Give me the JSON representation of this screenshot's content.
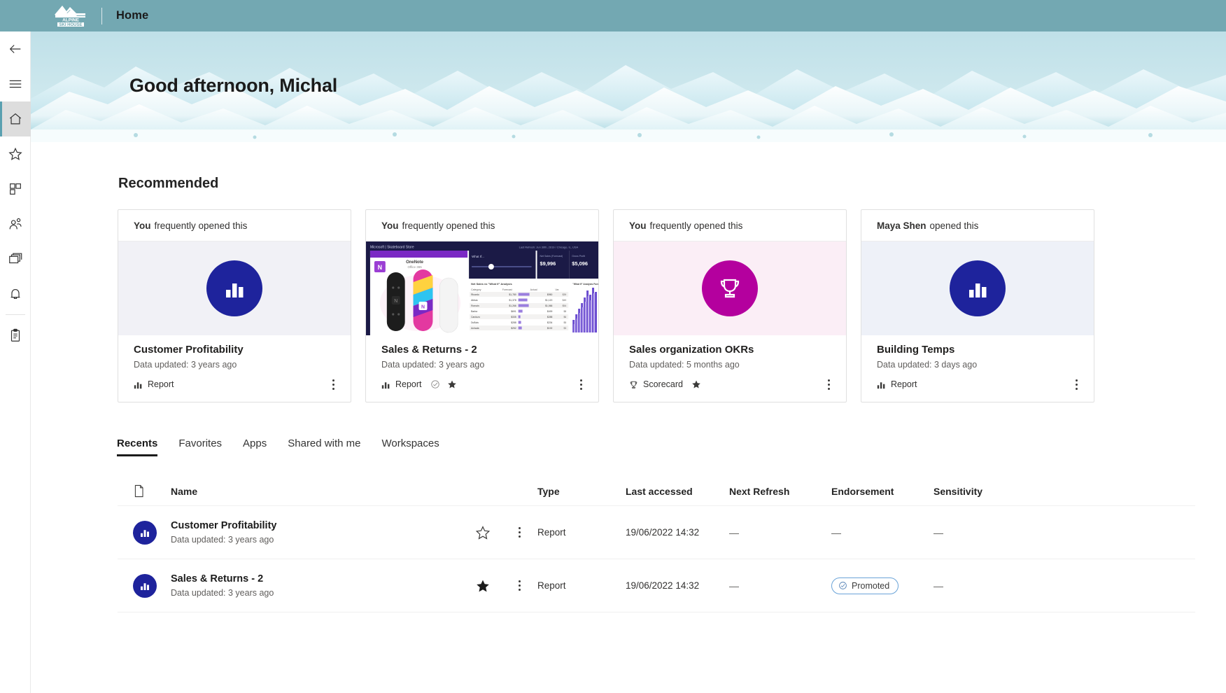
{
  "topbar": {
    "brand_line1": "ALPINE",
    "brand_line2": "SKI HOUSE",
    "title": "Home"
  },
  "rail": {
    "items": [
      {
        "name": "back",
        "label": "Back",
        "icon": "arrow-left-icon"
      },
      {
        "name": "menu",
        "label": "Show navigation",
        "icon": "hamburger-icon"
      },
      {
        "name": "home",
        "label": "Home",
        "icon": "home-icon",
        "selected": true
      },
      {
        "name": "favorites",
        "label": "Favorites",
        "icon": "star-icon"
      },
      {
        "name": "apps",
        "label": "Apps",
        "icon": "apps-grid-icon"
      },
      {
        "name": "shared-with-me",
        "label": "Shared with me",
        "icon": "people-icon"
      },
      {
        "name": "workspaces",
        "label": "Workspaces",
        "icon": "workspaces-stack-icon"
      },
      {
        "name": "notifications",
        "label": "Notifications",
        "icon": "bell-icon"
      },
      {
        "name": "metrics",
        "label": "Metrics",
        "icon": "clipboard-icon"
      }
    ]
  },
  "hero": {
    "greeting": "Good afternoon, Michal"
  },
  "main": {
    "recommended_title": "Recommended",
    "cards": [
      {
        "actor": "You",
        "activity": "frequently opened this",
        "thumb_kind": "circle-blue-bars",
        "thumb_bg": "#f1f1f6",
        "title": "Customer Profitability",
        "subtitle": "Data updated: 3 years ago",
        "type_label": "Report",
        "type_icon": "report-bars-icon",
        "certified": false,
        "favorite": false
      },
      {
        "actor": "You",
        "activity": "frequently opened this",
        "thumb_kind": "report-preview",
        "thumb_bg": "#1b1a46",
        "title": "Sales & Returns  - 2",
        "subtitle": "Data updated: 3 years ago",
        "type_label": "Report",
        "type_icon": "report-bars-icon",
        "certified": true,
        "favorite": true
      },
      {
        "actor": "You",
        "activity": "frequently opened this",
        "thumb_kind": "circle-magenta-trophy",
        "thumb_bg": "#fbeef6",
        "title": "Sales organization OKRs",
        "subtitle": "Data updated: 5 months ago",
        "type_label": "Scorecard",
        "type_icon": "trophy-icon",
        "certified": false,
        "favorite": true
      },
      {
        "actor": "Maya Shen",
        "activity": "opened this",
        "thumb_kind": "circle-blue-bars",
        "thumb_bg": "#eef1f8",
        "title": "Building Temps",
        "subtitle": "Data updated: 3 days ago",
        "type_label": "Report",
        "type_icon": "report-bars-icon",
        "certified": false,
        "favorite": false
      }
    ],
    "tabs": [
      {
        "label": "Recents",
        "active": true
      },
      {
        "label": "Favorites",
        "active": false
      },
      {
        "label": "Apps",
        "active": false
      },
      {
        "label": "Shared with me",
        "active": false
      },
      {
        "label": "Workspaces",
        "active": false
      }
    ],
    "table": {
      "columns": [
        {
          "key": "icon",
          "label": ""
        },
        {
          "key": "name",
          "label": "Name"
        },
        {
          "key": "star",
          "label": ""
        },
        {
          "key": "kebab",
          "label": ""
        },
        {
          "key": "type",
          "label": "Type"
        },
        {
          "key": "last_accessed",
          "label": "Last accessed"
        },
        {
          "key": "next_refresh",
          "label": "Next Refresh"
        },
        {
          "key": "endorsement",
          "label": "Endorsement"
        },
        {
          "key": "sensitivity",
          "label": "Sensitivity"
        }
      ],
      "rows": [
        {
          "icon": "report-avatar-icon",
          "name": "Customer Profitability",
          "name_sub": "Data updated: 3 years ago",
          "favorite": false,
          "type": "Report",
          "last_accessed": "19/06/2022 14:32",
          "next_refresh": "—",
          "endorsement": "—",
          "endorsement_badge": false,
          "sensitivity": "—"
        },
        {
          "icon": "report-avatar-icon",
          "name": "Sales & Returns  - 2",
          "name_sub": "Data updated: 3 years ago",
          "favorite": true,
          "type": "Report",
          "last_accessed": "19/06/2022 14:32",
          "next_refresh": "—",
          "endorsement": "Promoted",
          "endorsement_badge": true,
          "sensitivity": "—"
        }
      ]
    }
  },
  "colors": {
    "topbar": "#73a8b2",
    "accent_blue": "#1e239c",
    "accent_magenta": "#b4009e",
    "promoted_border": "#6aa3d8",
    "rail_selected": "#dddddd"
  }
}
